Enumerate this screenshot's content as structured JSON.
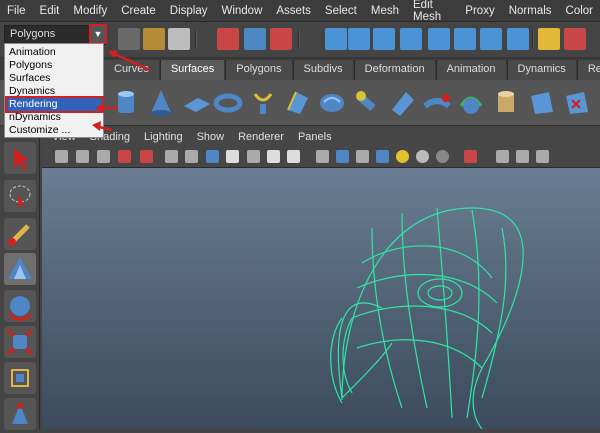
{
  "menubar": [
    "File",
    "Edit",
    "Modify",
    "Create",
    "Display",
    "Window",
    "Assets",
    "Select",
    "Mesh",
    "Edit Mesh",
    "Proxy",
    "Normals",
    "Color"
  ],
  "mode_selector": {
    "value": "Polygons",
    "arrow": "▼"
  },
  "dropdown": {
    "items": [
      "Animation",
      "Polygons",
      "Surfaces",
      "Dynamics",
      "Rendering",
      "nDynamics",
      "Customize ..."
    ],
    "highlighted": "Rendering"
  },
  "shelf_tabs": [
    "Curves",
    "Surfaces",
    "Polygons",
    "Subdivs",
    "Deformation",
    "Animation",
    "Dynamics",
    "Rend"
  ],
  "active_tab": "Surfaces",
  "viewport_menu": [
    "View",
    "Shading",
    "Lighting",
    "Show",
    "Renderer",
    "Panels"
  ],
  "colors": {
    "accent": "#d12020",
    "highlight": "#3261b8",
    "mesh": "#2ee6a6",
    "viewport_top": "#6a7d92",
    "viewport_bottom": "#3b4a5c"
  }
}
